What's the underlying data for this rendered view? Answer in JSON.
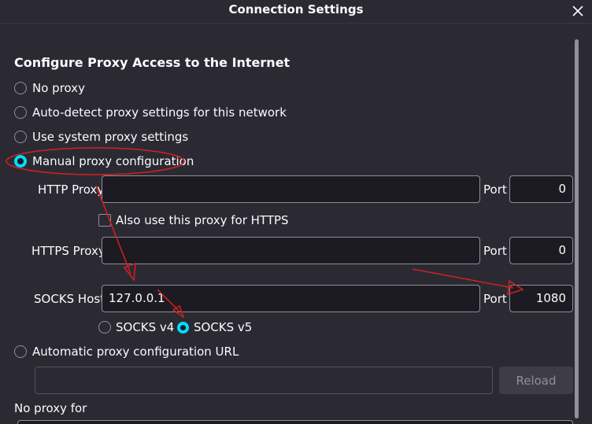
{
  "dialog": {
    "title": "Connection Settings",
    "close_icon": "close-icon"
  },
  "section": {
    "heading": "Configure Proxy Access to the Internet"
  },
  "proxy_options": [
    {
      "label": "No proxy",
      "selected": false
    },
    {
      "label": "Auto-detect proxy settings for this network",
      "selected": false
    },
    {
      "label": "Use system proxy settings",
      "selected": false
    },
    {
      "label": "Manual proxy configuration",
      "selected": true
    }
  ],
  "manual": {
    "http_label": "HTTP Proxy",
    "http_value": "",
    "http_port_label": "Port",
    "http_port": "0",
    "also_https_label": "Also use this proxy for HTTPS",
    "also_https_checked": false,
    "https_label": "HTTPS Proxy",
    "https_value": "",
    "https_port_label": "Port",
    "https_port": "0",
    "socks_label": "SOCKS Host",
    "socks_value": "127.0.0.1",
    "socks_port_label": "Port",
    "socks_port": "1080",
    "socks_v4_label": "SOCKS v4",
    "socks_v5_label": "SOCKS v5",
    "socks_version_selected": "SOCKS v5"
  },
  "auto_config": {
    "label": "Automatic proxy configuration URL",
    "url_value": "",
    "reload_label": "Reload"
  },
  "no_proxy_for_label": "No proxy for",
  "colors": {
    "background": "#2b2a33",
    "accent": "#00ddff",
    "annotation": "#d42020",
    "field_bg": "#1c1b22"
  }
}
